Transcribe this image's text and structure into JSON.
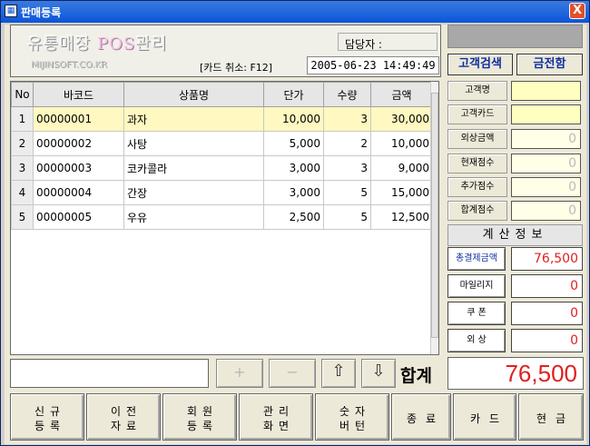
{
  "window": {
    "title": "판매등록",
    "close_label": "X"
  },
  "header": {
    "brand_prefix": "유통매장 ",
    "brand_pos": "POS",
    "brand_suffix": "관리",
    "domain": "MIJINSOFT.CO.KR",
    "card_cancel": "[카드 취소: F12]",
    "manager_label": "담당자 :",
    "datetime": "2005-06-23  14:49:49"
  },
  "grid": {
    "columns": [
      "No",
      "바코드",
      "상품명",
      "단가",
      "수량",
      "금액"
    ],
    "rows": [
      {
        "no": "1",
        "barcode": "00000001",
        "name": "과자",
        "price": "10,000",
        "qty": "3",
        "amount": "30,000"
      },
      {
        "no": "2",
        "barcode": "00000002",
        "name": "사탕",
        "price": "5,000",
        "qty": "2",
        "amount": "10,000"
      },
      {
        "no": "3",
        "barcode": "00000003",
        "name": "코카콜라",
        "price": "3,000",
        "qty": "3",
        "amount": "9,000"
      },
      {
        "no": "4",
        "barcode": "00000004",
        "name": "간장",
        "price": "3,000",
        "qty": "5",
        "amount": "15,000"
      },
      {
        "no": "5",
        "barcode": "00000005",
        "name": "우유",
        "price": "2,500",
        "qty": "5",
        "amount": "12,500"
      }
    ]
  },
  "entry": {
    "value": ""
  },
  "controls": {
    "plus": "+",
    "minus": "−",
    "up": "⇧",
    "down": "⇩"
  },
  "total": {
    "label": "합계",
    "value": "76,500"
  },
  "bottom_buttons": [
    {
      "l1": "신규",
      "l2": "등록"
    },
    {
      "l1": "이전",
      "l2": "자료"
    },
    {
      "l1": "회원",
      "l2": "등록"
    },
    {
      "l1": "관리",
      "l2": "화면"
    },
    {
      "l1": "숫자",
      "l2": "버턴"
    },
    {
      "single": "종료"
    },
    {
      "single": "카드"
    },
    {
      "single": "현금"
    }
  ],
  "customer": {
    "search_label": "고객검색",
    "cash_drawer_label": "금전함",
    "fields": [
      {
        "label": "고객명",
        "value": ""
      },
      {
        "label": "고객카드",
        "value": ""
      },
      {
        "label": "외상금액",
        "value": "0"
      },
      {
        "label": "현재점수",
        "value": "0"
      },
      {
        "label": "추가점수",
        "value": "0"
      },
      {
        "label": "합계점수",
        "value": "0"
      }
    ]
  },
  "calc": {
    "heading": "계산정보",
    "fields": [
      {
        "label": "총결제금액",
        "value": "76,500"
      },
      {
        "label": "마일리지",
        "value": "0"
      },
      {
        "label": "쿠 폰",
        "value": "0"
      },
      {
        "label": "외 상",
        "value": "0"
      }
    ]
  }
}
